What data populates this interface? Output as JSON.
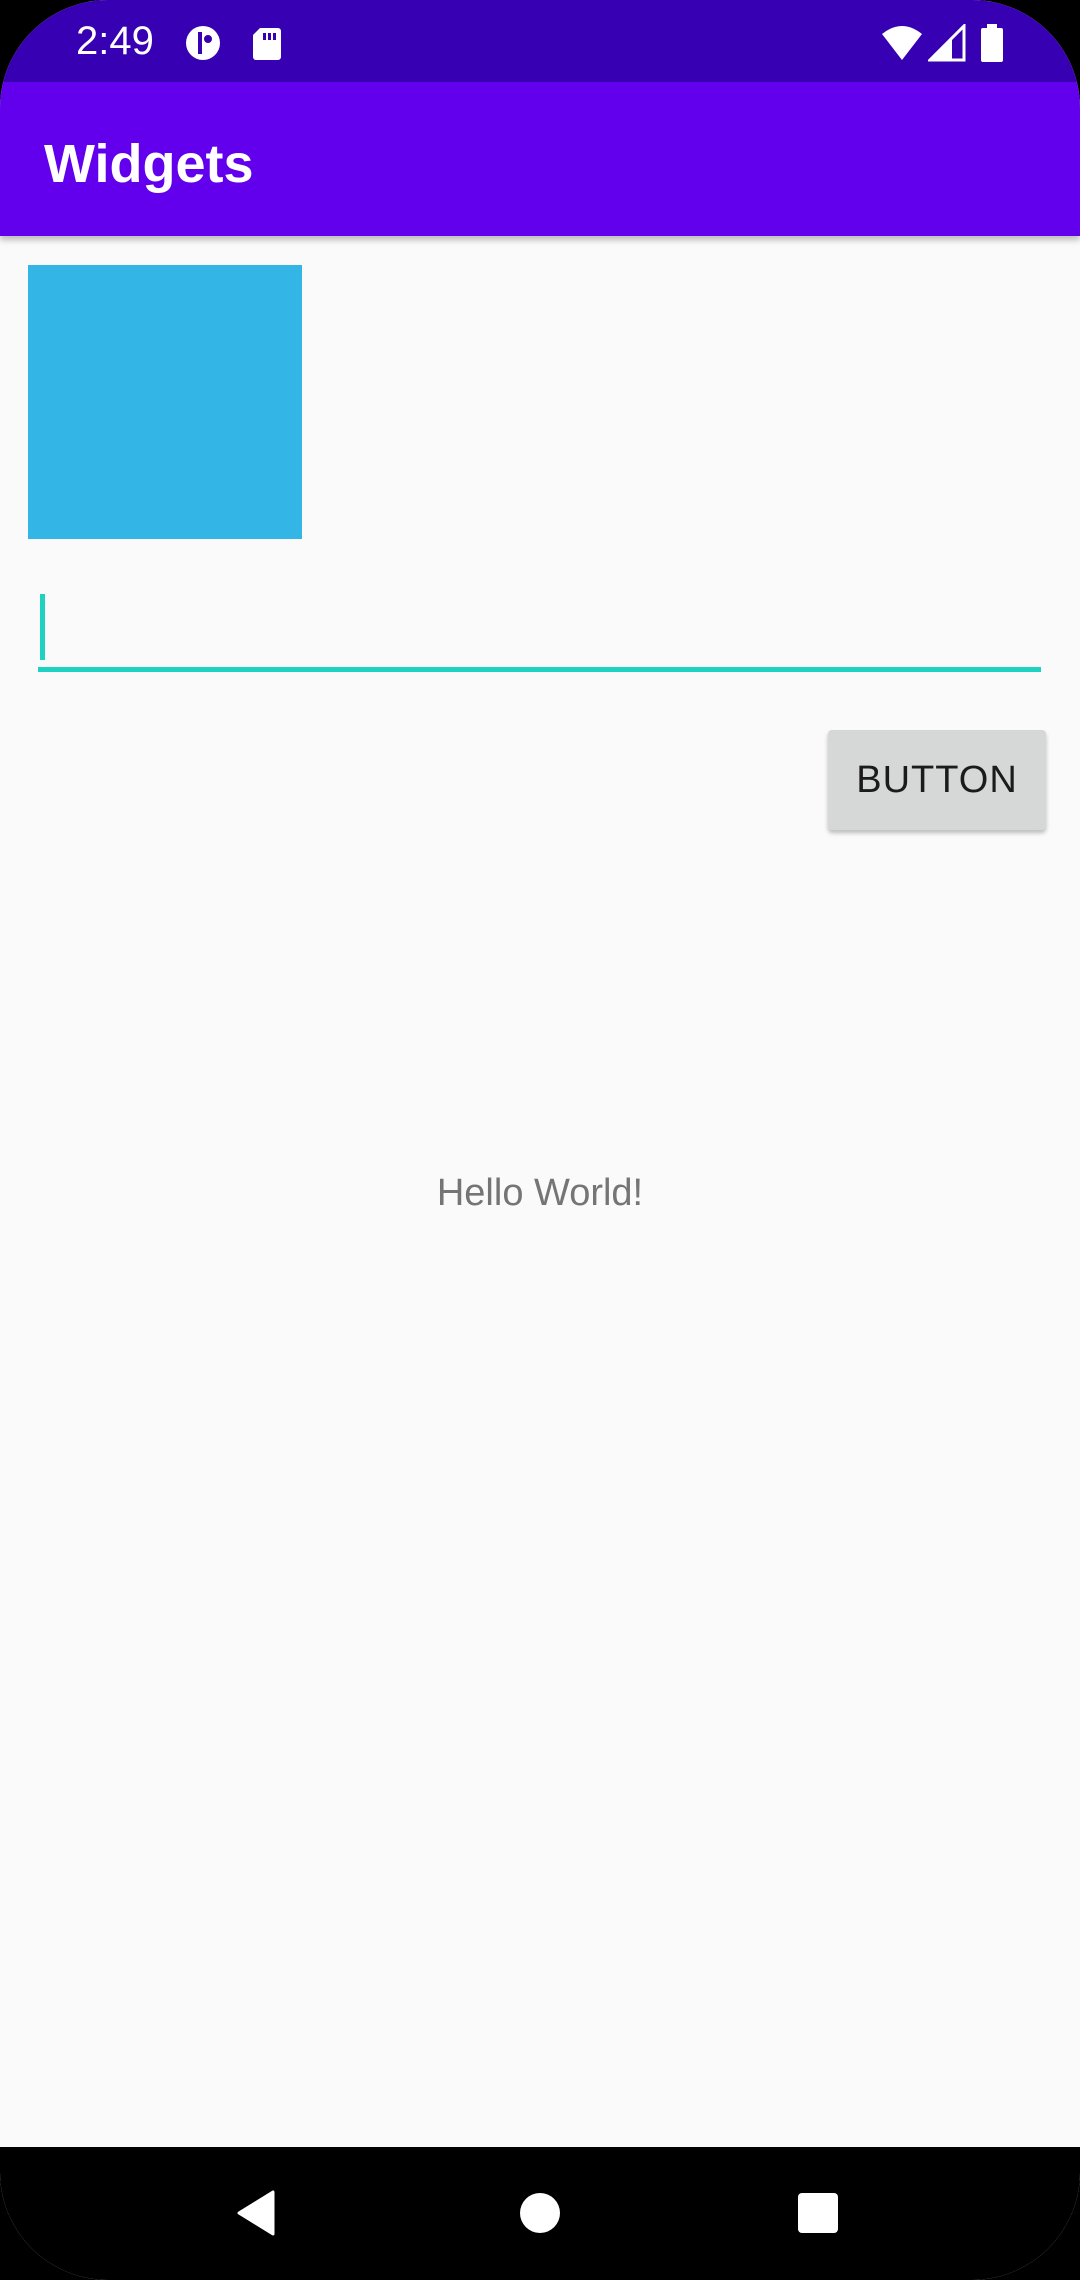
{
  "status_bar": {
    "time": "2:49",
    "left_icons": [
      "data-saver-icon",
      "sd-card-icon"
    ],
    "right_icons": [
      "wifi-icon",
      "cellular-signal-icon",
      "battery-icon"
    ],
    "background": "#3700b3"
  },
  "app_bar": {
    "title": "Widgets",
    "background": "#6200ee"
  },
  "content": {
    "image_view_color": "#33b5e5",
    "edit_text": {
      "value": "",
      "underline_color": "#1fd1c1"
    },
    "button_label": "BUTTON",
    "hello_text": "Hello World!"
  },
  "nav_bar": {
    "icons": [
      "back-icon",
      "home-icon",
      "recents-icon"
    ]
  }
}
